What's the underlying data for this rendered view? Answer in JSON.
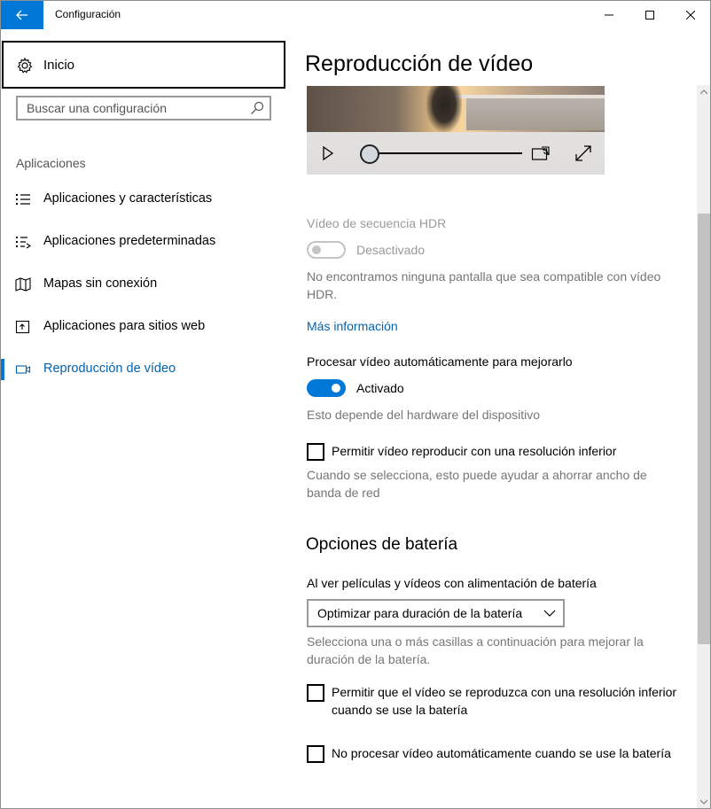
{
  "window": {
    "title": "Configuración",
    "accent": "#0078d7",
    "minimize_glyph": "—",
    "maximize_glyph": "☐",
    "close_glyph": "✕"
  },
  "sidebar": {
    "home_label": "Inicio",
    "search_placeholder": "Buscar una configuración",
    "section_label": "Aplicaciones",
    "items": [
      {
        "label": "Aplicaciones y características",
        "icon": "apps-list-icon"
      },
      {
        "label": "Aplicaciones predeterminadas",
        "icon": "default-apps-icon"
      },
      {
        "label": "Mapas sin conexión",
        "icon": "map-icon"
      },
      {
        "label": "Aplicaciones para sitios web",
        "icon": "web-app-icon"
      },
      {
        "label": "Reproducción de vídeo",
        "icon": "video-icon",
        "active": true
      }
    ]
  },
  "main": {
    "title": "Reproducción de vídeo",
    "video_preview": {
      "progress": 0.0
    },
    "hdr": {
      "label": "Vídeo de secuencia HDR",
      "toggle_state": "Desactivado",
      "description": "No encontramos ninguna pantalla que sea compatible con vídeo HDR.",
      "more_info": "Más información"
    },
    "auto_process": {
      "label": "Procesar vídeo automáticamente para mejorarlo",
      "toggle_state": "Activado",
      "description": "Esto depende del hardware del dispositivo"
    },
    "low_res": {
      "label": "Permitir vídeo reproducir con una resolución inferior",
      "description": "Cuando se selecciona, esto puede ayudar a ahorrar ancho de banda de red"
    },
    "battery": {
      "heading": "Opciones de batería",
      "dropdown_label": "Al ver películas y vídeos con alimentación de batería",
      "dropdown_value": "Optimizar para duración de la batería",
      "description": "Selecciona una o más casillas a continuación para mejorar la duración de la batería.",
      "check1": "Permitir que el vídeo se reproduzca con una resolución inferior cuando se use la batería",
      "check2": "No procesar vídeo automáticamente cuando se use la batería"
    }
  }
}
